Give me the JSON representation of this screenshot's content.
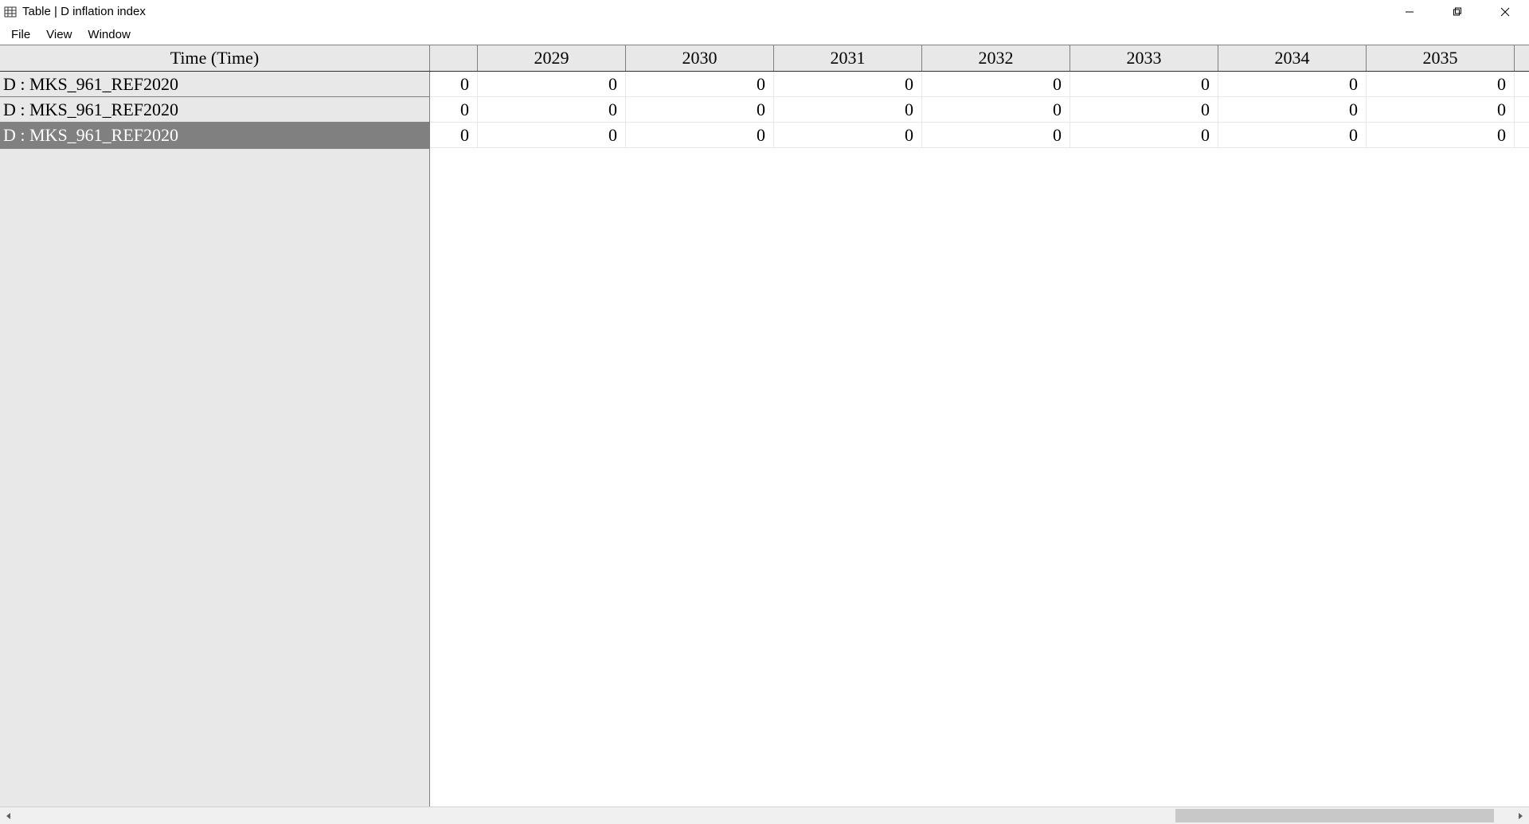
{
  "window": {
    "title": "Table | D inflation index"
  },
  "menu": {
    "items": [
      "File",
      "View",
      "Window"
    ]
  },
  "table": {
    "time_header": "Time (Time)",
    "year_headers": [
      "2029",
      "2030",
      "2031",
      "2032",
      "2033",
      "2034",
      "2035"
    ],
    "rows": [
      {
        "label": "D : MKS_961_REF2020",
        "first": "0",
        "values": [
          "0",
          "0",
          "0",
          "0",
          "0",
          "0",
          "0"
        ],
        "selected": false
      },
      {
        "label": "D : MKS_961_REF2020",
        "first": "0",
        "values": [
          "0",
          "0",
          "0",
          "0",
          "0",
          "0",
          "0"
        ],
        "selected": false
      },
      {
        "label": "D : MKS_961_REF2020",
        "first": "0",
        "values": [
          "0",
          "0",
          "0",
          "0",
          "0",
          "0",
          "0"
        ],
        "selected": true
      }
    ]
  }
}
